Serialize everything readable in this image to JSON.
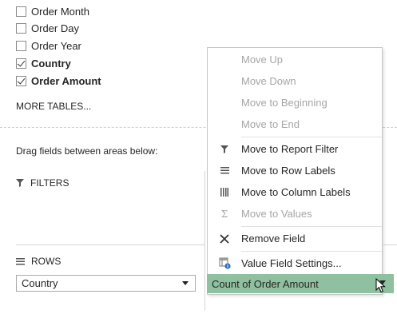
{
  "field_list": {
    "items": [
      {
        "label": "Order Month",
        "checked": false
      },
      {
        "label": "Order Day",
        "checked": false
      },
      {
        "label": "Order Year",
        "checked": false
      },
      {
        "label": "Country",
        "checked": true
      },
      {
        "label": "Order Amount",
        "checked": true
      }
    ],
    "more_tables": "MORE TABLES..."
  },
  "areas": {
    "drag_hint": "Drag fields between areas below:",
    "filters_title": "FILTERS",
    "rows_title": "ROWS",
    "rows_field": "Country"
  },
  "context_menu": {
    "items": [
      {
        "label": "Move Up",
        "enabled": false,
        "icon": "none"
      },
      {
        "label": "Move Down",
        "enabled": false,
        "icon": "none"
      },
      {
        "label": "Move to Beginning",
        "enabled": false,
        "icon": "none"
      },
      {
        "label": "Move to End",
        "enabled": false,
        "icon": "none"
      },
      {
        "label": "Move to Report Filter",
        "enabled": true,
        "icon": "filter-icon"
      },
      {
        "label": "Move to Row Labels",
        "enabled": true,
        "icon": "rows-icon"
      },
      {
        "label": "Move to Column Labels",
        "enabled": true,
        "icon": "columns-icon"
      },
      {
        "label": "Move to Values",
        "enabled": false,
        "icon": "sigma-icon"
      },
      {
        "label": "Remove Field",
        "enabled": true,
        "icon": "remove-icon"
      },
      {
        "label": "Value Field Settings...",
        "enabled": true,
        "icon": "field-settings-icon"
      }
    ]
  },
  "values_field": {
    "label": "Count of Order Amount",
    "highlight_color": "#8fc09f"
  }
}
